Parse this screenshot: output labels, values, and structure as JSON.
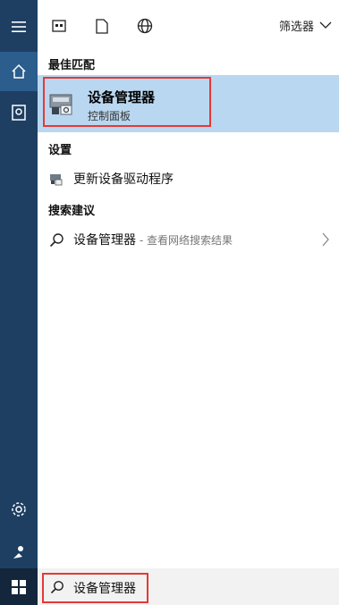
{
  "toolbar": {
    "filter_label": "筛选器",
    "icons": [
      "apps-icon",
      "document-icon",
      "web-icon",
      "chevron-down-icon"
    ]
  },
  "sections": {
    "best_match": "最佳匹配",
    "settings": "设置",
    "suggestions": "搜索建议"
  },
  "best_match": {
    "title": "设备管理器",
    "subtitle": "控制面板",
    "icon": "device-manager-icon"
  },
  "settings_item": {
    "label": "更新设备驱动程序",
    "icon": "device-settings-icon"
  },
  "suggestion": {
    "label": "设备管理器",
    "hint": " - 查看网络搜索结果",
    "icon": "search-icon"
  },
  "search": {
    "value": "设备管理器"
  },
  "rail": {
    "items": [
      "hamburger-menu-icon",
      "home-icon",
      "notebook-icon",
      "settings-icon",
      "feedback-icon",
      "windows-start-icon"
    ]
  },
  "colors": {
    "rail": "#1e3f62",
    "rail_active": "#2b5d8d",
    "highlight": "#b9d7f0",
    "annotation": "#e53935"
  }
}
